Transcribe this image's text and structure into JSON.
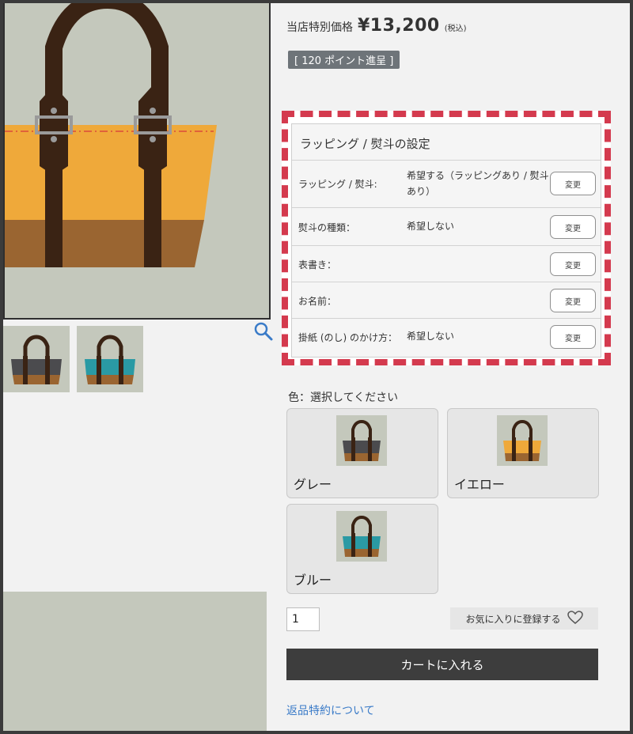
{
  "price": {
    "label": "当店特別価格",
    "value": "¥13,200",
    "tax": "(税込)"
  },
  "points": "[ 120 ポイント進呈 ]",
  "wrapping": {
    "title": "ラッピング / 熨斗の設定",
    "rows": [
      {
        "label": "ラッピング / 熨斗:",
        "value": "希望する（ラッピングあり / 熨斗あり）",
        "button": "変更"
      },
      {
        "label": "熨斗の種類：",
        "value": "希望しない",
        "button": "変更"
      },
      {
        "label": "表書き：",
        "value": "",
        "button": "変更"
      },
      {
        "label": "お名前：",
        "value": "",
        "button": "変更"
      },
      {
        "label": "掛紙 (のし) のかけ方：",
        "value": "希望しない",
        "button": "変更"
      }
    ]
  },
  "colors": {
    "label": "色：選択してください",
    "options": [
      {
        "name": "グレー",
        "body_color": "#4b4b4e"
      },
      {
        "name": "イエロー",
        "body_color": "#efa93a"
      },
      {
        "name": "ブルー",
        "body_color": "#2a9aa4"
      }
    ]
  },
  "quantity": "1",
  "favorite": {
    "label": "お気に入りに登録する",
    "icon": "heart-icon"
  },
  "cart_button": "カートに入れる",
  "return_link": "返品特約について",
  "theme": {
    "accent_dashed": "#d43a4e",
    "link": "#3a7bc8",
    "bag_strap": "#3a2314",
    "bag_bottom": "#9a6531"
  }
}
